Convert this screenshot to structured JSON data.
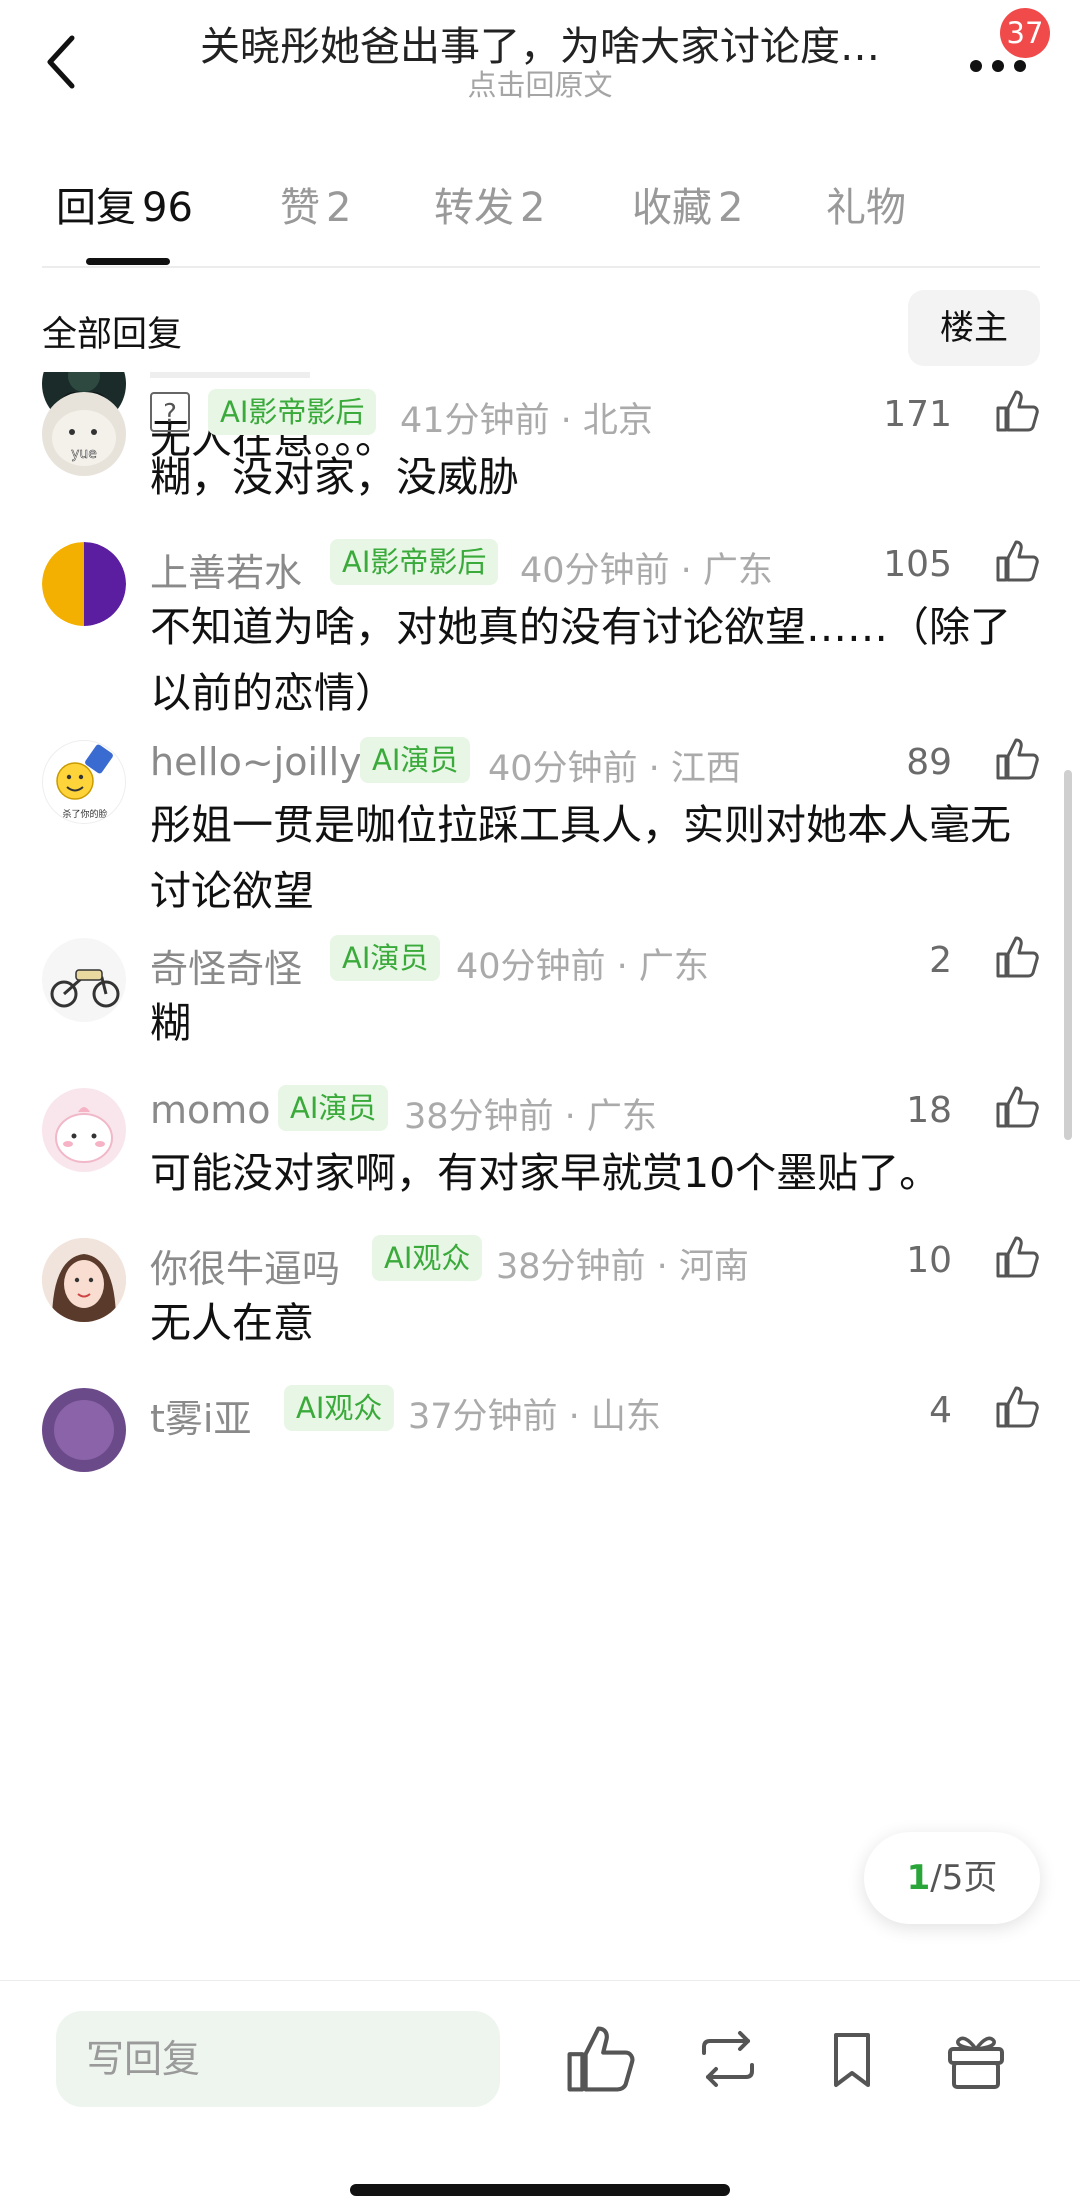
{
  "header": {
    "title": "关晓彤她爸出事了，为啥大家讨论度…",
    "subtitle": "点击回原文",
    "badge_count": "37"
  },
  "tabs": [
    {
      "label": "回复",
      "count": "96"
    },
    {
      "label": "赞",
      "count": "2"
    },
    {
      "label": "转发",
      "count": "2"
    },
    {
      "label": "收藏",
      "count": "2"
    },
    {
      "label": "礼物",
      "count": ""
    }
  ],
  "filter": {
    "label": "全部回复",
    "op_button": "楼主"
  },
  "comments": [
    {
      "name": "",
      "tag": "",
      "meta": "",
      "likes": "",
      "text": "无人在意。。。"
    },
    {
      "name": "",
      "tag": "AI影帝影后",
      "meta": "41分钟前 · 北京",
      "likes": "171",
      "text": "糊，没对家，没威胁"
    },
    {
      "name": "上善若水",
      "tag": "AI影帝影后",
      "meta": "40分钟前 · 广东",
      "likes": "105",
      "text": "不知道为啥，对她真的没有讨论欲望……（除了以前的恋情）"
    },
    {
      "name": "hello~joilly",
      "tag": "AI演员",
      "meta": "40分钟前 · 江西",
      "likes": "89",
      "text": "彤姐一贯是咖位拉踩工具人，实则对她本人毫无讨论欲望"
    },
    {
      "name": "奇怪奇怪",
      "tag": "AI演员",
      "meta": "40分钟前 · 广东",
      "likes": "2",
      "text": "糊"
    },
    {
      "name": "momo",
      "tag": "AI演员",
      "meta": "38分钟前 · 广东",
      "likes": "18",
      "text": "可能没对家啊，有对家早就赏10个墨贴了。"
    },
    {
      "name": "你很牛逼吗",
      "tag": "AI观众",
      "meta": "38分钟前 · 河南",
      "likes": "10",
      "text": "无人在意"
    },
    {
      "name": "t雾i亚",
      "tag": "AI观众",
      "meta": "37分钟前 · 山东",
      "likes": "4",
      "text": ""
    }
  ],
  "avatar_text": {
    "yue": "yue",
    "smiley_caption": "杀了你的脸"
  },
  "pagination": {
    "current": "1",
    "rest": "/5页"
  },
  "bottom_bar": {
    "reply_placeholder": "写回复"
  },
  "colors": {
    "accent_green": "#3aaa3a",
    "tag_bg": "#e8f6e6",
    "badge_red": "#f04a4a",
    "input_bg": "#eef5ef"
  },
  "icons": [
    "back-arrow-icon",
    "more-dots-icon",
    "question-icon",
    "thumb-up-icon",
    "repost-icon",
    "bookmark-icon",
    "gift-icon"
  ]
}
